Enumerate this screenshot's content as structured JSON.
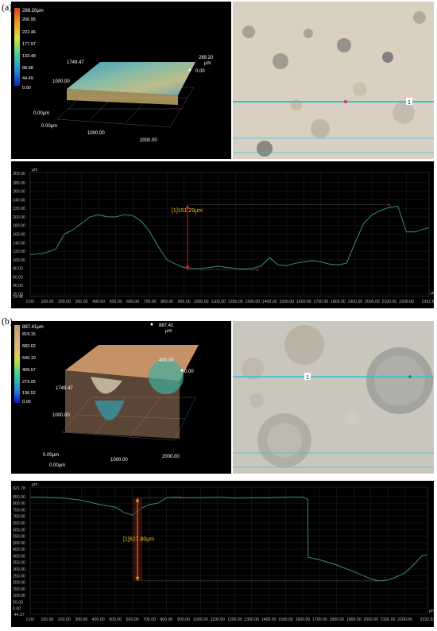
{
  "panels": [
    {
      "label": "(a)",
      "colorbar": {
        "unit_max": "289.20μm",
        "ticks": [
          "266.95",
          "222.46",
          "177.97",
          "133.48",
          "88.98",
          "44.49",
          "0.00"
        ]
      },
      "surface_labels": {
        "top_value": "289.20",
        "top_unit": "μm",
        "bottom_value": "0.00",
        "y_depth": "1749.47",
        "y_mid": "1000.00",
        "z_origin": "0.00μm",
        "x_origin": "0.00μm",
        "x_mid": "1000.00",
        "x_end": "2000.00"
      },
      "marker_label": "1",
      "measurement": "[1]151.29μm"
    },
    {
      "label": "(b)",
      "colorbar": {
        "unit_max": "887.41μm",
        "ticks": [
          "819.15",
          "682.62",
          "546.10",
          "409.57",
          "273.05",
          "136.52",
          "0.00"
        ]
      },
      "surface_labels": {
        "top_value": "887.41",
        "top_unit": "μm",
        "mid_value": "400.00",
        "bottom_value": "0.00",
        "y_depth": "1749.47",
        "y_mid": "1000.00",
        "z_origin": "0.00μm",
        "x_origin": "0.00μm",
        "x_mid": "1000.00",
        "x_end": "2000.00"
      },
      "marker_label": "1",
      "measurement": "[1]627.80μm"
    }
  ],
  "colors": {
    "profile_line": "#3a8a8a",
    "arrow_a": "#e02020",
    "arrow_b": "#d4a017",
    "label_yellow": "#e8c21a",
    "scan_line": "#2ec4d6",
    "grid": "#2a2a2a"
  },
  "chart_data": [
    {
      "type": "line",
      "title": "",
      "y_unit": "μm",
      "y_top_label": "303.66",
      "y_bottom_label": "14.46",
      "ylim": [
        14.46,
        303.66
      ],
      "y_ticks": [
        "280.00",
        "260.00",
        "240.00",
        "220.00",
        "200.00",
        "180.00",
        "160.00",
        "140.00",
        "120.00",
        "100.00",
        "80.00",
        "60.00",
        "40.00",
        "20.00"
      ],
      "x_unit": "μm",
      "x_ticks": [
        "0.00",
        "100.00",
        "200.00",
        "300.00",
        "400.00",
        "500.00",
        "600.00",
        "700.00",
        "800.00",
        "900.00",
        "1000.00",
        "1100.00",
        "1200.00",
        "1300.00",
        "1400.00",
        "1500.00",
        "1600.00",
        "1700.00",
        "1800.00",
        "1900.00",
        "2000.00",
        "2100.00",
        "2200.00",
        "2332.63"
      ],
      "xlim": [
        0,
        2332.63
      ],
      "series": [
        {
          "x": [
            0,
            80,
            150,
            200,
            250,
            300,
            350,
            400,
            450,
            500,
            550,
            600,
            650,
            700,
            750,
            800,
            850,
            900,
            950,
            1000,
            1050,
            1100,
            1150,
            1200,
            1250,
            1300,
            1350,
            1400,
            1450,
            1500,
            1550,
            1600,
            1650,
            1700,
            1750,
            1800,
            1850,
            1900,
            1950,
            2000,
            2050,
            2100,
            2150,
            2200,
            2250,
            2332
          ],
          "y": [
            112,
            115,
            125,
            160,
            170,
            185,
            200,
            205,
            200,
            200,
            205,
            203,
            190,
            165,
            130,
            100,
            90,
            82,
            80,
            80,
            82,
            85,
            82,
            80,
            78,
            80,
            85,
            105,
            88,
            86,
            92,
            95,
            98,
            95,
            90,
            88,
            92,
            140,
            185,
            205,
            215,
            222,
            225,
            165,
            165,
            175
          ]
        }
      ],
      "markers": [
        {
          "x": 1330,
          "y": 76
        },
        {
          "x": 2100,
          "y": 228
        }
      ],
      "measurement": {
        "label": "[1]151.29μm",
        "x": 920,
        "y_from": 76,
        "y_to": 228
      }
    },
    {
      "type": "line",
      "title": "",
      "y_unit": "μm",
      "y_top_label": "921.78",
      "y_bottom_label": "-44.37",
      "ylim": [
        -44.37,
        921.78
      ],
      "y_ticks": [
        "850.00",
        "800.00",
        "750.00",
        "700.00",
        "650.00",
        "600.00",
        "550.00",
        "500.00",
        "450.00",
        "400.00",
        "350.00",
        "300.00",
        "250.00",
        "200.00",
        "150.00",
        "100.00",
        "50.00",
        "0.00"
      ],
      "x_unit": "μm",
      "x_ticks": [
        "0.00",
        "100.00",
        "200.00",
        "300.00",
        "400.00",
        "500.00",
        "600.00",
        "700.00",
        "800.00",
        "900.00",
        "1000.00",
        "1100.00",
        "1200.00",
        "1300.00",
        "1400.00",
        "1500.00",
        "1600.00",
        "1700.00",
        "1800.00",
        "1900.00",
        "2000.00",
        "2100.00",
        "2200.00",
        "2332.63"
      ],
      "xlim": [
        0,
        2332.63
      ],
      "series": [
        {
          "x": [
            0,
            100,
            200,
            300,
            400,
            500,
            550,
            600,
            650,
            700,
            750,
            800,
            850,
            900,
            1000,
            1100,
            1200,
            1300,
            1400,
            1500,
            1600,
            1630,
            1632,
            1700,
            1800,
            1900,
            2000,
            2050,
            2100,
            2150,
            2200,
            2250,
            2300,
            2332
          ],
          "y": [
            845,
            843,
            838,
            822,
            792,
            770,
            730,
            710,
            760,
            790,
            800,
            840,
            845,
            840,
            840,
            845,
            838,
            840,
            840,
            845,
            845,
            830,
            390,
            370,
            330,
            280,
            225,
            210,
            215,
            240,
            270,
            330,
            400,
            410
          ]
        }
      ],
      "markers": [
        {
          "x": 2030,
          "y": 210
        },
        {
          "x": 880,
          "y": 840
        }
      ],
      "measurement": {
        "label": "[1]627.80μm",
        "x": 630,
        "y_from": 210,
        "y_to": 840
      }
    }
  ]
}
